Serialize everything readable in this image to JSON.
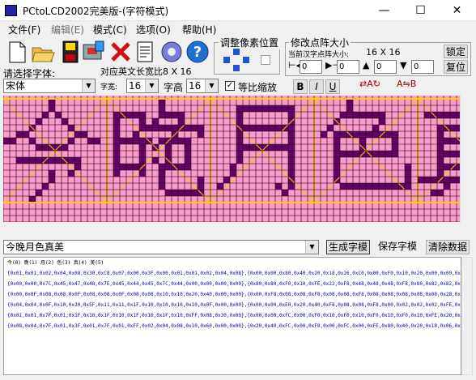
{
  "window": {
    "title": "PCtoLCD2002完美版-(字符模式)",
    "minimize": "—",
    "maximize": "☐",
    "close": "✕"
  },
  "menu": [
    "文件(F)",
    "编辑(E)",
    "模式(C)",
    "选项(O)",
    "帮助(H)"
  ],
  "toolbar": {
    "icons": [
      "new-file-icon",
      "open-folder-icon",
      "save-disk-icon",
      "save-as-icon",
      "close-x-icon",
      "notes-icon",
      "gear-icon",
      "help-icon"
    ]
  },
  "labels": {
    "select_font": "请选择字体:",
    "ascii_width": "对应英文长宽比8 X 16",
    "char_width": "字宽:",
    "char_height": "字高",
    "proportional": "等比缩放",
    "adjust_pixel": "调整像素位置",
    "modify_size": "修改点阵大小",
    "current_size": "当前汉字点阵大小:",
    "size_value": "16 X 16",
    "lock": "锁定",
    "restore": "复位"
  },
  "font": {
    "name": "宋体",
    "width": "16",
    "height": "16"
  },
  "spinners": [
    "0",
    "0",
    "0",
    "0"
  ],
  "style_buttons": [
    "B",
    "I",
    "U"
  ],
  "bottom": {
    "input_text": "今晚月色真美",
    "generate": "生成字模",
    "save": "保存字模",
    "clear": "清除数据"
  },
  "output": {
    "header": "今(0) 晚(1) 月(2) 色(3) 真(4) 美(5)",
    "lines": [
      "{0x01,0x01,0x02,0x04,0x08,0x30,0xC8,0x07,0x00,0x3F,0x00,0x01,0x01,0x02,0x04,0x08},{0x00,0x00,0x80,0x40,0x20,0x18,0x26,0xC0,0x00,0xF0,0x10,0x20,0x00,0x00,0x00,0x00},/*\"今\",0*/",
      "{0x00,0x00,0x7C,0x45,0x47,0x48,0x7E,0x45,0x44,0x45,0x7C,0x44,0x00,0x00,0x00,0x00},{0x80,0x80,0xF0,0x10,0xFE,0x22,0xF8,0x48,0x48,0x48,0xF8,0x80,0x82,0x82,0x7E,0x00},/*\"晚\",1*/",
      "{0x00,0x0F,0x08,0x08,0x0F,0x08,0x08,0x0F,0x08,0x08,0x10,0x10,0x20,0x40,0x00,0x00},{0x00,0xF8,0x08,0x08,0xF8,0x08,0x08,0xF8,0x08,0x08,0x08,0x08,0x08,0x28,0x10,0x00},/*\"月\",2*/",
      "{0x04,0x04,0x0F,0x10,0x20,0x5F,0x11,0x11,0x1F,0x10,0x10,0x10,0x10,0x0F,0x00,0x00},{0x00,0x00,0xE0,0x20,0x40,0xF8,0x08,0x08,0xF8,0x00,0x02,0x02,0x02,0xFE,0x00,0x00},/*\"色\",3*/",
      "{0x01,0x01,0x7F,0x01,0x1F,0x10,0x1F,0x10,0x1F,0x10,0x1F,0x10,0xFF,0x08,0x30,0x00},{0x00,0x00,0xFC,0x00,0xF0,0x10,0xF0,0x10,0xF0,0x10,0xF0,0x10,0xFE,0x20,0x18,0x00},/*\"真\",4*/",
      "{0x08,0x04,0x7F,0x01,0x3F,0x01,0x7F,0x01,0xFF,0x02,0x04,0x08,0x10,0x60,0x00,0x00},{0x20,0x40,0xFC,0x00,0xF8,0x00,0xFC,0x00,0xFE,0x80,0x40,0x20,0x18,0x06,0x00,0x00},/*\"美\",5*/"
    ]
  },
  "colors": {
    "pixel_on": "#660066",
    "pixel_off": "#ff99cc",
    "grid": "#000000",
    "divider": "#ffcc00"
  }
}
